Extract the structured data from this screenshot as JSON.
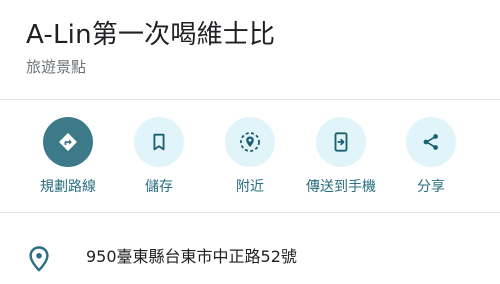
{
  "place": {
    "name": "A-Lin第一次喝維士比",
    "category": "旅遊景點"
  },
  "actions": [
    {
      "id": "directions",
      "label": "規劃路線",
      "icon": "directions-icon"
    },
    {
      "id": "save",
      "label": "儲存",
      "icon": "bookmark-icon"
    },
    {
      "id": "nearby",
      "label": "附近",
      "icon": "nearby-icon"
    },
    {
      "id": "send-to-phone",
      "label": "傳送到手機",
      "icon": "send-to-phone-icon"
    },
    {
      "id": "share",
      "label": "分享",
      "icon": "share-icon"
    }
  ],
  "address": {
    "text": "950臺東縣台東市中正路52號",
    "icon": "location-pin-icon"
  },
  "colors": {
    "primary_action_bg": "#3d7a89",
    "action_bg": "#e1f4fa",
    "accent_text": "#2b6f80",
    "icon_dark": "#1b5f70"
  }
}
